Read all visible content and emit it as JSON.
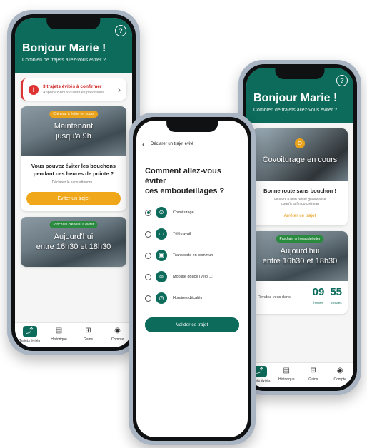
{
  "phone_left": {
    "greeting": "Bonjour Marie !",
    "subtitle": "Combien de trajets allez-vous éviter ?",
    "alert": {
      "title": "3 trajets évités à confirmer",
      "subtitle": "Apportez-nous quelques précisions"
    },
    "card1": {
      "pill": "Créneau à éviter en cours",
      "overlay_line1": "Maintenant",
      "overlay_line2": "jusqu'à 9h",
      "text_line1": "Vous pouvez éviter les bouchons",
      "text_line2": "pendant ces heures de pointe ?",
      "hint": "Déclarez le sans attendre...",
      "button": "Éviter un trajet"
    },
    "card2": {
      "pill": "Prochain créneau à éviter",
      "overlay_line1": "Aujourd'hui",
      "overlay_line2": "entre 16h30 et 18h30"
    },
    "tabs": [
      {
        "label": "Trajets évités",
        "icon": "route-icon"
      },
      {
        "label": "Historique",
        "icon": "document-icon"
      },
      {
        "label": "Gains",
        "icon": "gift-icon"
      },
      {
        "label": "Compte",
        "icon": "user-icon"
      }
    ]
  },
  "phone_center": {
    "title": "Déclarer un trajet évité",
    "question_line1": "Comment allez-vous éviter",
    "question_line2": "ces embouteillages ?",
    "options": [
      {
        "label": "Covoiturage",
        "icon": "car-icon",
        "selected": true
      },
      {
        "label": "Télétravail",
        "icon": "laptop-icon",
        "selected": false
      },
      {
        "label": "Transports en commun",
        "icon": "bus-icon",
        "selected": false
      },
      {
        "label": "Mobilité douce (vélo,...)",
        "icon": "bike-icon",
        "selected": false
      },
      {
        "label": "Horaires décalés",
        "icon": "clock-icon",
        "selected": false
      }
    ],
    "button": "Valider ce trajet"
  },
  "phone_right": {
    "greeting": "Bonjour Marie !",
    "subtitle": "Combien de trajets allez-vous éviter ?",
    "card1": {
      "overlay": "Covoiturage en cours",
      "text": "Bonne route sans bouchon !",
      "hint_line1": "Veuillez à bien rester géolocalisé",
      "hint_line2": "jusqu'à la fin du créneau",
      "link": "Arrêter ce trajet"
    },
    "card2": {
      "pill": "Prochain créneau à éviter",
      "overlay_line1": "Aujourd'hui",
      "overlay_line2": "entre 16h30 et 18h30",
      "timer_label": "Rendez-vous dans",
      "hours": "09",
      "hours_unit": "heures",
      "minutes": "55",
      "minutes_unit": "minutes"
    },
    "tabs": [
      {
        "label": "Trajets évités",
        "icon": "route-icon"
      },
      {
        "label": "Historique",
        "icon": "document-icon"
      },
      {
        "label": "Gains",
        "icon": "gift-icon"
      },
      {
        "label": "Compte",
        "icon": "user-icon"
      }
    ]
  },
  "colors": {
    "brand_green": "#0c6b5a",
    "accent_orange": "#f0a81a",
    "alert_red": "#d33333"
  }
}
